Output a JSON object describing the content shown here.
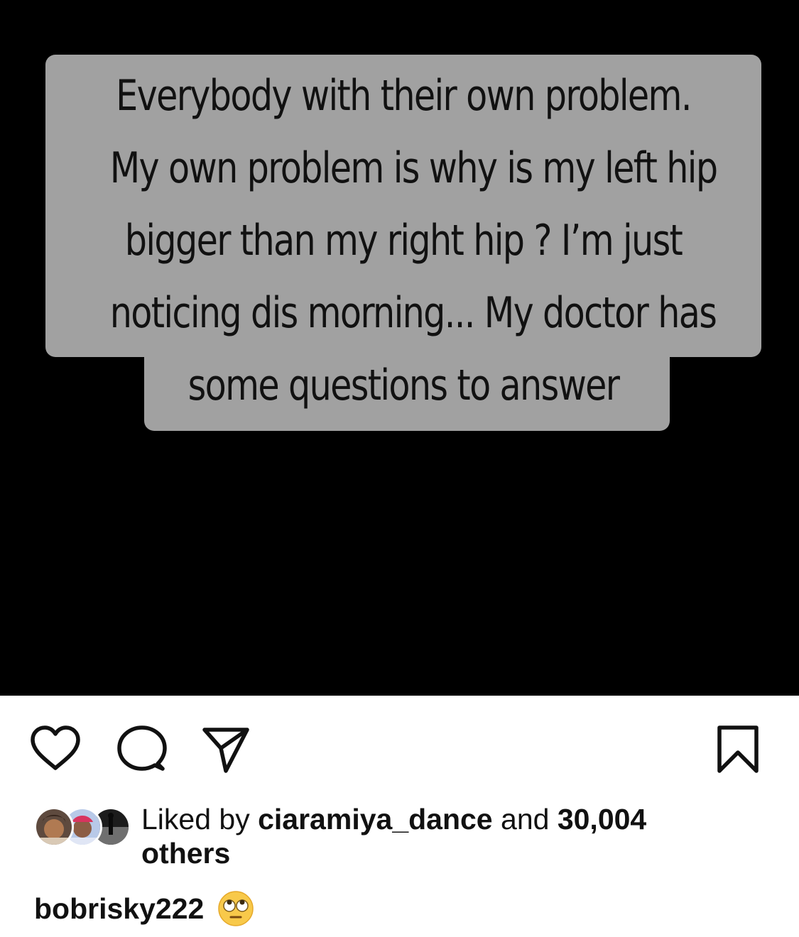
{
  "post": {
    "story_lines": [
      "Everybody with their own problem.",
      "My own problem is why is my left hip",
      "bigger than my right hip ? I’m just",
      "noticing dis morning... My doctor has",
      "some questions to answer"
    ],
    "background_color": "#000000",
    "text_box_color": "#a1a1a1"
  },
  "actions": {
    "like_icon": "heart-icon",
    "comment_icon": "comment-icon",
    "share_icon": "send-icon",
    "save_icon": "bookmark-icon"
  },
  "likes": {
    "prefix": "Liked by ",
    "liked_by_user": "ciaramiya_dance",
    "middle": " and ",
    "count": "30,004",
    "suffix": "others"
  },
  "caption": {
    "username": "bobrisky222",
    "emoji": "face-with-rolling-eyes"
  }
}
